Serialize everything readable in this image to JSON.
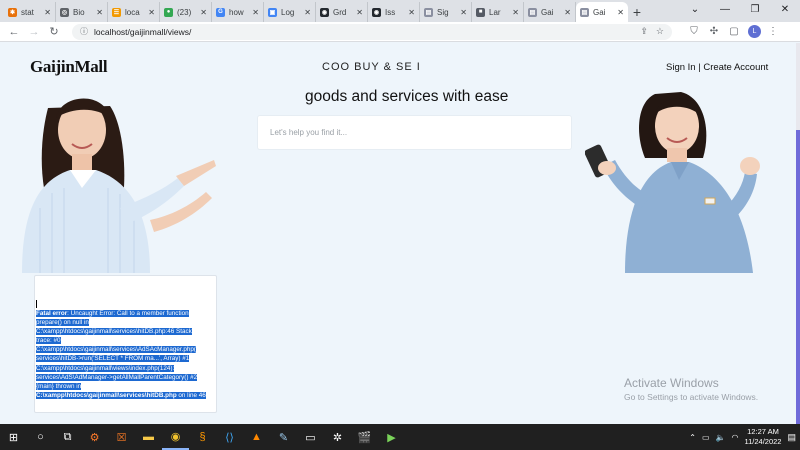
{
  "browser": {
    "tabs": [
      {
        "title": "stat",
        "color": "#e8710a",
        "glyph": "✱"
      },
      {
        "title": "Bio",
        "color": "#5f6368",
        "glyph": "◎"
      },
      {
        "title": "loca",
        "color": "#f29900",
        "glyph": "☰"
      },
      {
        "title": "(23)",
        "color": "#34a853",
        "glyph": "●"
      },
      {
        "title": "how",
        "color": "#4285f4",
        "glyph": "G"
      },
      {
        "title": "Log",
        "color": "#4285f4",
        "glyph": "▣"
      },
      {
        "title": "Grd",
        "color": "#24292f",
        "glyph": "◉"
      },
      {
        "title": "Iss",
        "color": "#24292f",
        "glyph": "◉"
      },
      {
        "title": "Sig",
        "color": "#8a8fa0",
        "glyph": "▤"
      },
      {
        "title": "Lar",
        "color": "#555a64",
        "glyph": "■"
      },
      {
        "title": "Gai",
        "color": "#8a8fa0",
        "glyph": "▤"
      },
      {
        "title": "Gai",
        "color": "#8a8fa0",
        "glyph": "▤",
        "active": true
      }
    ],
    "url": "localhost/gaijinmall/views/",
    "profile_initial": "L"
  },
  "site": {
    "logo": "GaijinMall",
    "tagline": "COO  BUY & SE  I",
    "sign_in": "Sign In",
    "separator": " | ",
    "create_account": "Create Account",
    "headline": "goods and services with ease",
    "search_placeholder": "Let's help you find it..."
  },
  "error": {
    "lines": [
      {
        "bold": "Fatal error",
        "text": ": Uncaught Error: Call to a member function"
      },
      {
        "text": "prepare() on null in"
      },
      {
        "text": "C:\\xampp\\htdocs\\gaijinmall\\services\\hitDB.php:46 Stack"
      },
      {
        "text": "trace: #0"
      },
      {
        "text": "C:\\xampp\\htdocs\\gaijinmall\\services\\AdSAcManager.php("
      },
      {
        "text": "services\\hitDB->run('SELECT * FROM ma...', Array) #1"
      },
      {
        "text": "C:\\xampp\\htdocs\\gaijinmall\\views\\index.php(124):"
      },
      {
        "text": "services\\AdS\\AdManager->getAllMallParentCategory() #2"
      },
      {
        "text": "{main} thrown in"
      },
      {
        "bold": "C:\\xampp\\htdocs\\gaijinmall\\services\\hitDB.php",
        "text": " on line 46"
      }
    ]
  },
  "watermark": {
    "title": "Activate Windows",
    "subtitle": "Go to Settings to activate Windows."
  },
  "taskbar": {
    "time": "12:27 AM",
    "date": "11/24/2022"
  }
}
